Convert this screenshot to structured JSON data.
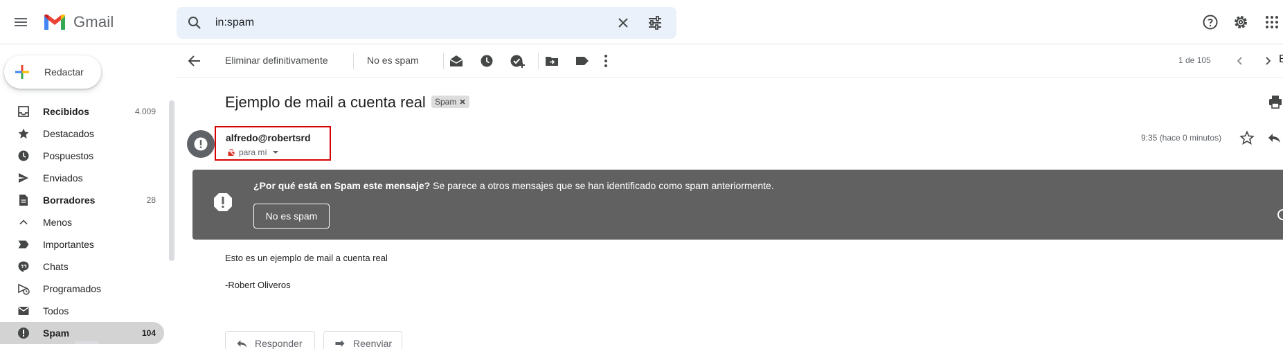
{
  "app": {
    "name": "Gmail"
  },
  "search": {
    "value": "in:spam"
  },
  "sidebar": {
    "compose_label": "Redactar",
    "items": [
      {
        "label": "Recibidos",
        "count": "4.009",
        "icon": "inbox-icon"
      },
      {
        "label": "Destacados",
        "count": "",
        "icon": "star-icon"
      },
      {
        "label": "Pospuestos",
        "count": "",
        "icon": "clock-icon"
      },
      {
        "label": "Enviados",
        "count": "",
        "icon": "send-icon"
      },
      {
        "label": "Borradores",
        "count": "28",
        "icon": "draft-icon"
      },
      {
        "label": "Menos",
        "count": "",
        "icon": "chevron-up-icon"
      },
      {
        "label": "Importantes",
        "count": "",
        "icon": "label-important-icon"
      },
      {
        "label": "Chats",
        "count": "",
        "icon": "chat-icon"
      },
      {
        "label": "Programados",
        "count": "",
        "icon": "scheduled-icon"
      },
      {
        "label": "Todos",
        "count": "",
        "icon": "mail-icon"
      },
      {
        "label": "Spam",
        "count": "104",
        "icon": "spam-icon"
      }
    ]
  },
  "toolbar": {
    "delete_forever": "Eliminar definitivamente",
    "not_spam": "No es spam",
    "pager": "1 de 105",
    "edge_text": "E"
  },
  "message": {
    "subject": "Ejemplo de mail a cuenta real",
    "label_chip": "Spam",
    "sender": "alfredo@robertsrd",
    "to": "para mí",
    "time": "9:35 (hace 0 minutos)",
    "banner": {
      "question": "¿Por qué está en Spam este mensaje?",
      "explanation": " Se parece a otros mensajes que se han identificado como spam anteriormente.",
      "button": "No es spam"
    },
    "body": [
      "Esto es un ejemplo de mail a cuenta real",
      "-Robert Oliveros"
    ],
    "reply_label": "Responder",
    "forward_label": "Reenviar"
  },
  "colors": {
    "accent_red": "#d50000",
    "banner_bg": "#616161",
    "search_bg": "#eaf1fb",
    "active_nav_bg": "#d3d3d3"
  }
}
